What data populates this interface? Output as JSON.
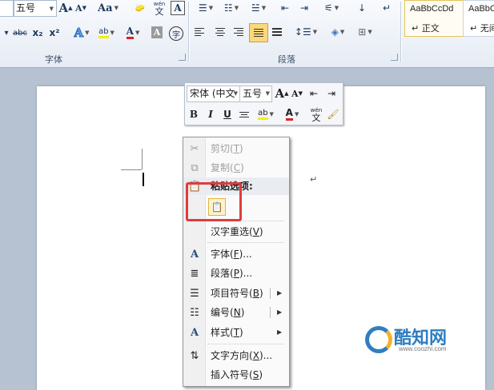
{
  "ribbon": {
    "font_name_partial": "",
    "font_size": "五号",
    "font_group_label": "字体",
    "paragraph_group_label": "段落",
    "format_glyphs": {
      "strikethrough": "abc",
      "subscript": "x₂",
      "superscript": "x²",
      "font_color": "A",
      "char_shading": "A",
      "phonetic": "文",
      "char_border": "A",
      "change_case": "Aa",
      "grow": "A",
      "shrink": "A",
      "enclose": "字"
    },
    "styles": [
      {
        "sample": "AaBbCcDd",
        "name": "正文",
        "prefix": "↵"
      },
      {
        "sample": "AaBbC",
        "name": "无间",
        "prefix": "↵"
      }
    ]
  },
  "mini_toolbar": {
    "font_name": "宋体 (中文",
    "font_size": "五号",
    "bold": "B",
    "italic": "I",
    "underline": "U",
    "font_color": "A",
    "phonetic": "文",
    "grow": "A",
    "shrink": "A"
  },
  "context_menu": {
    "cut": {
      "label": "剪切",
      "key": "T"
    },
    "copy": {
      "label": "复制",
      "key": "C"
    },
    "paste_options": "粘贴选项:",
    "reconvert": {
      "label": "汉字重选",
      "key": "V"
    },
    "font": {
      "label": "字体",
      "key": "F",
      "suffix": "..."
    },
    "paragraph": {
      "label": "段落",
      "key": "P",
      "suffix": "..."
    },
    "bullets": {
      "label": "项目符号",
      "key": "B"
    },
    "numbering": {
      "label": "编号",
      "key": "N"
    },
    "styles": {
      "label": "样式",
      "key": "T"
    },
    "text_direction": {
      "label": "文字方向",
      "key": "X",
      "suffix": "..."
    },
    "insert_symbol": {
      "label": "插入符号",
      "key": "S"
    }
  },
  "document": {
    "paragraph_mark": "↵"
  },
  "watermark": {
    "brand": "酷知网",
    "url": "www.coozhi.com"
  },
  "colors": {
    "highlight_box": "#e03c3c",
    "paste_icon_border": "#e0b341",
    "watermark_blue": "#2f7ec1"
  }
}
